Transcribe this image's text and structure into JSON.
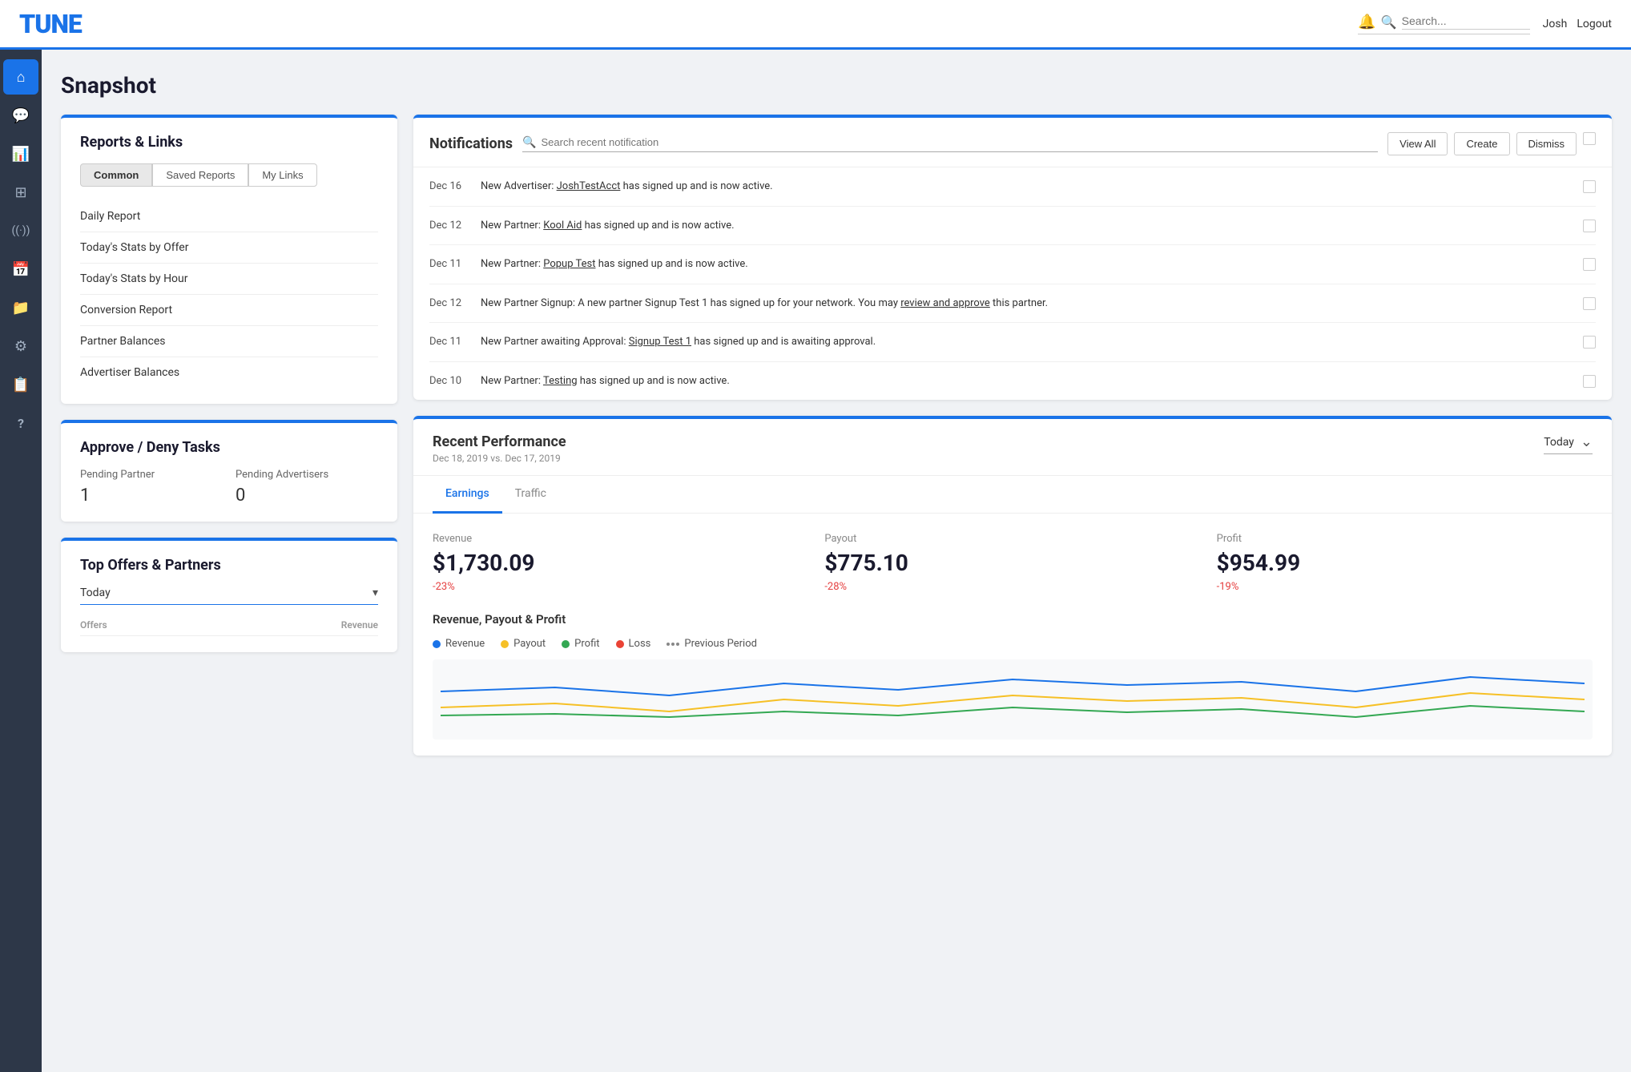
{
  "header": {
    "logo": "TUNE",
    "search_placeholder": "Search...",
    "user": "Josh",
    "logout": "Logout",
    "bell_icon": "bell",
    "search_icon": "search"
  },
  "sidebar": {
    "items": [
      {
        "id": "home",
        "icon": "⌂",
        "label": "Home",
        "active": true
      },
      {
        "id": "messages",
        "icon": "💬",
        "label": "Messages"
      },
      {
        "id": "reports",
        "icon": "📊",
        "label": "Reports"
      },
      {
        "id": "grid",
        "icon": "⊞",
        "label": "Grid"
      },
      {
        "id": "signal",
        "icon": "📡",
        "label": "Signal"
      },
      {
        "id": "calendar",
        "icon": "📅",
        "label": "Calendar"
      },
      {
        "id": "folder",
        "icon": "📁",
        "label": "Folder"
      },
      {
        "id": "settings",
        "icon": "⚙",
        "label": "Settings"
      },
      {
        "id": "table",
        "icon": "📋",
        "label": "Table"
      },
      {
        "id": "help",
        "icon": "?",
        "label": "Help"
      }
    ]
  },
  "page": {
    "title": "Snapshot"
  },
  "reports_links": {
    "title": "Reports & Links",
    "tabs": [
      "Common",
      "Saved Reports",
      "My Links"
    ],
    "active_tab": "Common",
    "links": [
      "Daily Report",
      "Today's Stats by Offer",
      "Today's Stats by Hour",
      "Conversion Report",
      "Partner Balances",
      "Advertiser Balances"
    ]
  },
  "notifications": {
    "title": "Notifications",
    "search_placeholder": "Search recent notification",
    "buttons": [
      "View All",
      "Create",
      "Dismiss"
    ],
    "items": [
      {
        "date": "Dec 16",
        "text": "New Advertiser: JoshTestAcct has signed up and is now active.",
        "underline": "JoshTestAcct"
      },
      {
        "date": "Dec 12",
        "text": "New Partner: Kool Aid has signed up and is now active.",
        "underline": "Kool Aid"
      },
      {
        "date": "Dec 11",
        "text": "New Partner: Popup Test has signed up and is now active.",
        "underline": "Popup Test"
      },
      {
        "date": "Dec 12",
        "text": "New Partner Signup: A new partner Signup Test 1 has signed up for your network. You may review and approve this partner.",
        "underline": "review and approve"
      },
      {
        "date": "Dec 11",
        "text": "New Partner awaiting Approval: Signup Test 1 has signed up and is awaiting approval.",
        "underline": "Signup Test 1"
      },
      {
        "date": "Dec 10",
        "text": "New Partner: Testing has signed up and is now active.",
        "underline": "Testing"
      }
    ]
  },
  "approve_tasks": {
    "title": "Approve / Deny Tasks",
    "pending_partner_label": "Pending Partner",
    "pending_partner_value": "1",
    "pending_advertisers_label": "Pending Advertisers",
    "pending_advertisers_value": "0"
  },
  "top_offers": {
    "title": "Top Offers & Partners",
    "period": "Today",
    "col1": "Offers",
    "col2": "Revenue"
  },
  "recent_performance": {
    "title": "Recent Performance",
    "subtitle": "Dec 18, 2019 vs. Dec 17, 2019",
    "period": "Today",
    "tabs": [
      "Earnings",
      "Traffic"
    ],
    "active_tab": "Earnings",
    "stats": {
      "revenue": {
        "label": "Revenue",
        "value": "$1,730.09",
        "change": "-23%"
      },
      "payout": {
        "label": "Payout",
        "value": "$775.10",
        "change": "-28%"
      },
      "profit": {
        "label": "Profit",
        "value": "$954.99",
        "change": "-19%"
      }
    },
    "chart": {
      "title": "Revenue, Payout & Profit",
      "legend": [
        {
          "label": "Revenue",
          "color": "#1a73e8"
        },
        {
          "label": "Payout",
          "color": "#f6c026"
        },
        {
          "label": "Profit",
          "color": "#34a853"
        },
        {
          "label": "Loss",
          "color": "#ea4335"
        },
        {
          "label": "Previous Period",
          "type": "dots"
        }
      ]
    }
  }
}
